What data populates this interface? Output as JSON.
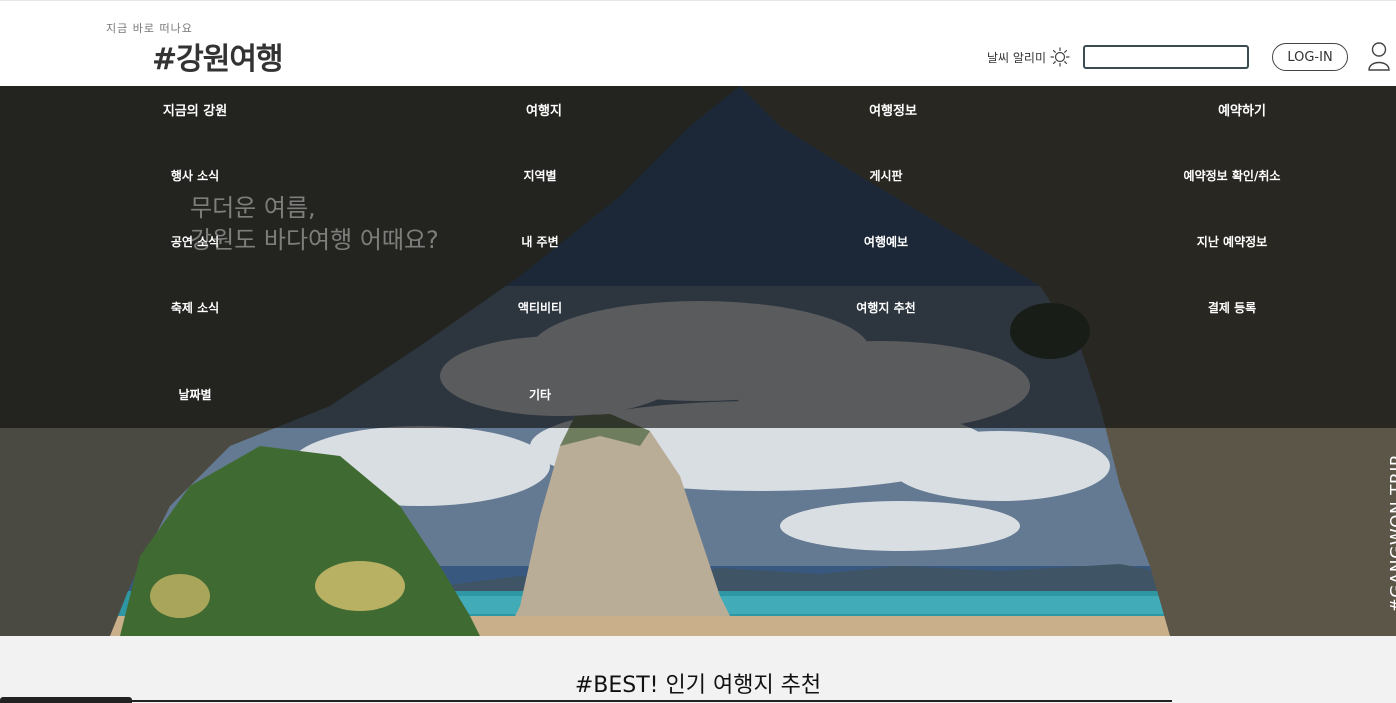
{
  "header": {
    "tagline": "지금 바로 떠나요",
    "logo": "#강원여행",
    "weather_label": "날씨 알리미",
    "weather_icon": "sun-icon",
    "search_value": "",
    "login_label": "LOG-IN",
    "user_icon": "user-icon"
  },
  "nav": {
    "columns": [
      {
        "title": "지금의 강원",
        "items": [
          "행사 소식",
          "공연 소식",
          "축제 소식",
          "날짜별"
        ]
      },
      {
        "title": "여행지",
        "items": [
          "지역별",
          "내 주변",
          "액티비티",
          "기타"
        ]
      },
      {
        "title": "여행정보",
        "items": [
          "게시판",
          "여행예보",
          "여행지 추천"
        ]
      },
      {
        "title": "예약하기",
        "items": [
          "예약정보 확인/취소",
          "지난 예약정보",
          "결제 등록"
        ]
      }
    ]
  },
  "hero": {
    "copy_line1": "무더운 여름,",
    "copy_line2": "강원도 바다여행 어때요?",
    "vertical_text": "#GANGWON TRIP"
  },
  "best": {
    "title": "#BEST! 인기 여행지 추천"
  },
  "colors": {
    "header_bg": "#ffffff",
    "overlay": "rgba(12,12,12,0.62)",
    "sea": "#2a8a98",
    "section_bg": "#f2f2f2"
  }
}
